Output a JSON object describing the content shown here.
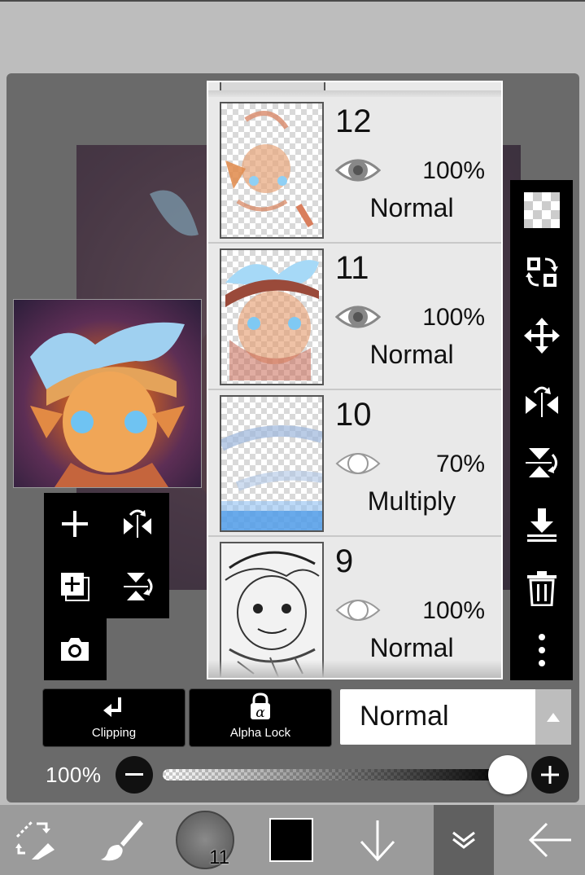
{
  "colors": {
    "accent": "#000000",
    "panel": "#6a6a6a",
    "toolbar": "#9b9b9b",
    "foreground_color": "#000000"
  },
  "layers": [
    {
      "number": "12",
      "opacity": "100%",
      "blend": "Normal",
      "visible": true
    },
    {
      "number": "11",
      "opacity": "100%",
      "blend": "Normal",
      "visible": true
    },
    {
      "number": "10",
      "opacity": "70%",
      "blend": "Multiply",
      "visible": false
    },
    {
      "number": "9",
      "opacity": "100%",
      "blend": "Normal",
      "visible": false
    }
  ],
  "layer_tools": {
    "add_layer": "plus-icon",
    "flip_horizontal": "flip-horizontal-icon",
    "duplicate_layer": "duplicate-layer-icon",
    "flip_vertical": "flip-vertical-icon",
    "import_photo": "camera-icon"
  },
  "right_tools": [
    "transparency-icon",
    "layer-swap-icon",
    "move-icon",
    "flip-horizontal-icon",
    "flip-vertical-icon",
    "merge-down-icon",
    "trash-icon",
    "more-icon"
  ],
  "clipping": {
    "label": "Clipping"
  },
  "alpha_lock": {
    "label": "Alpha Lock",
    "glyph": "α"
  },
  "blend_mode": {
    "value": "Normal"
  },
  "opacity": {
    "label": "100%",
    "value": 100
  },
  "bottom_toolbar": {
    "brush_size": "11"
  }
}
